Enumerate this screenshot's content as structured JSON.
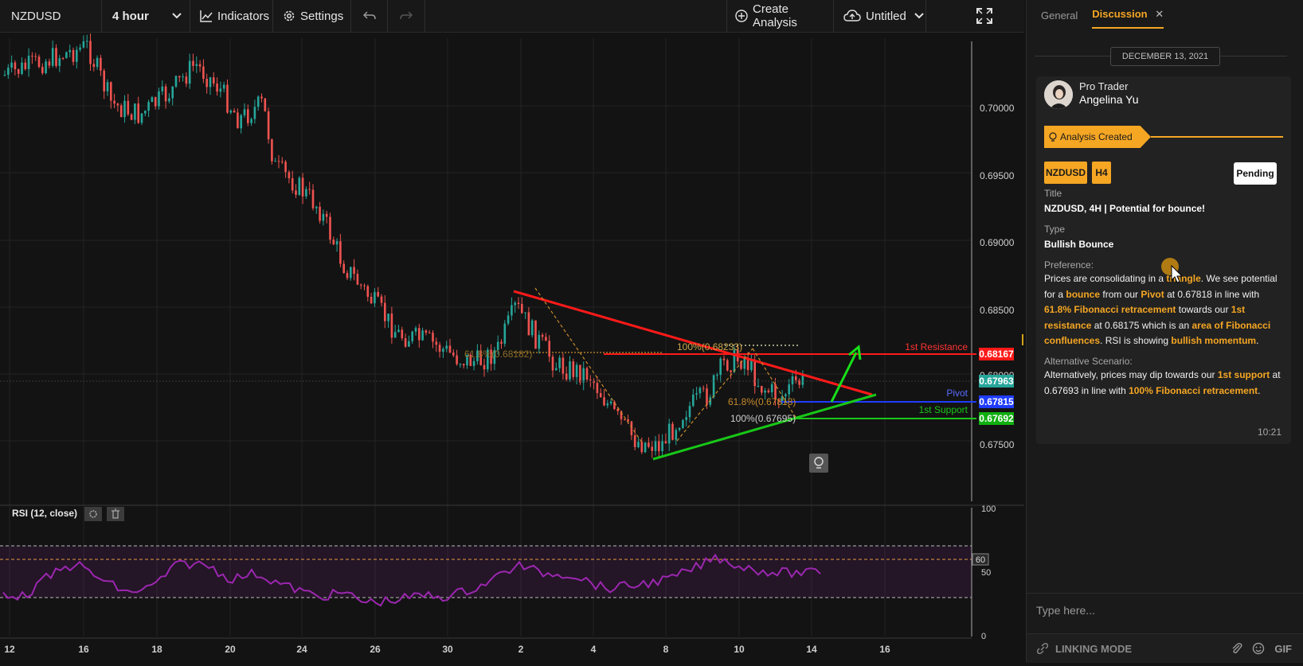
{
  "toolbar": {
    "symbol": "NZDUSD",
    "timeframe": "4 hour",
    "indicators_label": "Indicators",
    "settings_label": "Settings",
    "create_analysis_label": "Create Analysis",
    "layout_name": "Untitled"
  },
  "chart": {
    "price_ticks": [
      "0.70000",
      "0.69500",
      "0.69000",
      "0.68500",
      "0.68000",
      "0.67500"
    ],
    "x_ticks": [
      "12",
      "16",
      "18",
      "20",
      "24",
      "26",
      "30",
      "2",
      "4",
      "8",
      "10",
      "14",
      "16"
    ],
    "price_tags": {
      "resistance": {
        "value": "0.68167",
        "color": "#ff1a1a",
        "label": "1st Resistance"
      },
      "last_price": {
        "value": "0.67963",
        "color": "#26a69a"
      },
      "pivot": {
        "value": "0.67815",
        "color": "#1f3cff",
        "label": "Pivot"
      },
      "support": {
        "value": "0.67692",
        "color": "#10b010",
        "label": "1st Support"
      }
    },
    "fib_labels": {
      "top_100": "100%(0.68233)",
      "top_618": "61.8%(0.68182)",
      "bottom_618": "61.8%(0.67818)",
      "bottom_100": "100%(0.67695)"
    },
    "rsi": {
      "label": "RSI (12, close)",
      "scale": [
        "100",
        "50",
        "0"
      ],
      "level_60": "60",
      "color": "#9c27b0"
    }
  },
  "panel": {
    "tabs": [
      "General",
      "Discussion"
    ],
    "date": "DECEMBER 13, 2021",
    "author_role": "Pro Trader",
    "author_name": "Angelina Yu",
    "banner": "Analysis Created",
    "pair_tag": "NZDUSD",
    "tf_tag": "H4",
    "status": "Pending",
    "title_label": "Title",
    "title_value": "NZDUSD, 4H | Potential for bounce!",
    "type_label": "Type",
    "type_value": "Bullish Bounce",
    "preference_label": "Preference:",
    "preference_parts": [
      {
        "t": "Prices are consolidating in a ",
        "h": false
      },
      {
        "t": "triangle",
        "h": true
      },
      {
        "t": ". We see potential for a ",
        "h": false
      },
      {
        "t": "bounce",
        "h": true
      },
      {
        "t": " from our ",
        "h": false
      },
      {
        "t": "Pivot",
        "h": true
      },
      {
        "t": " at 0.67818 in line with ",
        "h": false
      },
      {
        "t": "61.8% Fibonacci retracement",
        "h": true
      },
      {
        "t": " towards our ",
        "h": false
      },
      {
        "t": "1st resistance",
        "h": true
      },
      {
        "t": " at 0.68175 which is an ",
        "h": false
      },
      {
        "t": "area of Fibonacci confluences",
        "h": true
      },
      {
        "t": ". RSI is showing ",
        "h": false
      },
      {
        "t": "bullish momentum",
        "h": true
      },
      {
        "t": ".",
        "h": false
      }
    ],
    "alt_label": "Alternative Scenario:",
    "alt_parts": [
      {
        "t": "Alternatively, prices may dip towards our ",
        "h": false
      },
      {
        "t": "1st support",
        "h": true
      },
      {
        "t": " at 0.67693 in line with ",
        "h": false
      },
      {
        "t": "100% Fibonacci retracement",
        "h": true
      },
      {
        "t": ".",
        "h": false
      }
    ],
    "time": "10:21",
    "input_placeholder": "Type here...",
    "linking_mode": "LINKING MODE",
    "gif_label": "GIF"
  }
}
